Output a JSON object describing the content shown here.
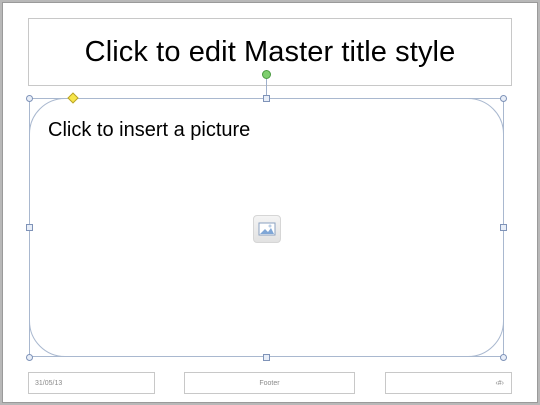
{
  "slide": {
    "title_placeholder": "Click to edit Master title style",
    "picture_placeholder": "Click to insert a picture",
    "picture_icon": "insert-picture-icon",
    "date": "31/05/13",
    "footer": "Footer",
    "slide_number": "‹#›"
  },
  "colors": {
    "selection_border": "#a9b8cf",
    "rotation_handle": "#7fcf6f",
    "adjustment_handle": "#f7e64a"
  }
}
